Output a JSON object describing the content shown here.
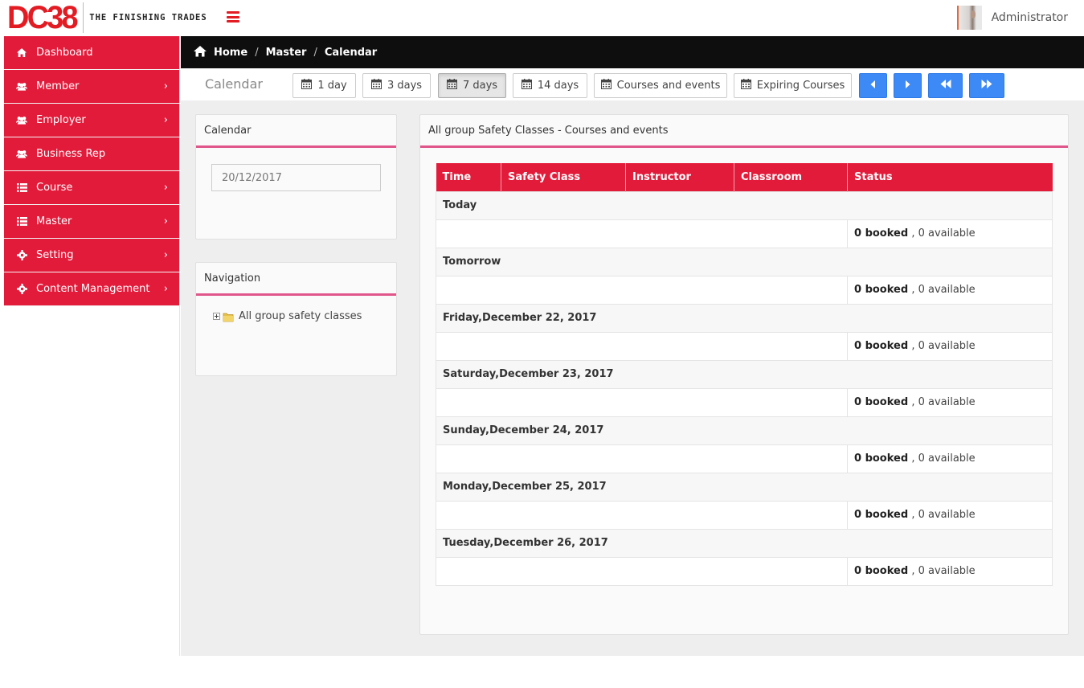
{
  "header": {
    "logo_text": "DC38",
    "tagline": "THE FINISHING TRADES",
    "user_name": "Administrator"
  },
  "sidebar": {
    "items": [
      {
        "label": "Dashboard",
        "icon": "home-icon",
        "has_children": false
      },
      {
        "label": "Member",
        "icon": "users-icon",
        "has_children": true
      },
      {
        "label": "Employer",
        "icon": "users-icon",
        "has_children": true
      },
      {
        "label": "Business Rep",
        "icon": "users-icon",
        "has_children": false
      },
      {
        "label": "Course",
        "icon": "list-icon",
        "has_children": true
      },
      {
        "label": "Master",
        "icon": "list-icon",
        "has_children": true
      },
      {
        "label": "Setting",
        "icon": "gear-icon",
        "has_children": true
      },
      {
        "label": "Content Management",
        "icon": "gear-icon",
        "has_children": true
      }
    ]
  },
  "breadcrumb": {
    "items": [
      "Home",
      "Master",
      "Calendar"
    ],
    "separator": "/"
  },
  "toolbar": {
    "title": "Calendar",
    "buttons": [
      {
        "label": "1 day",
        "active": false
      },
      {
        "label": "3 days",
        "active": false
      },
      {
        "label": "7 days",
        "active": true
      },
      {
        "label": "14 days",
        "active": false
      },
      {
        "label": "Courses and events",
        "active": false
      },
      {
        "label": "Expiring Courses",
        "active": false
      }
    ],
    "nav_buttons": [
      "caret-left-icon",
      "caret-right-icon",
      "fast-backward-icon",
      "fast-forward-icon"
    ]
  },
  "calendar_panel": {
    "title": "Calendar",
    "date_value": "20/12/2017"
  },
  "navigation_panel": {
    "title": "Navigation",
    "tree_item": "All group safety classes"
  },
  "schedule_panel": {
    "title": "All group Safety Classes - Courses and events",
    "columns": [
      "Time",
      "Safety Class",
      "Instructor",
      "Classroom",
      "Status"
    ],
    "booked_suffix": ", 0 available",
    "days": [
      {
        "label": "Today",
        "booked": "0 booked",
        "available": ", 0 available"
      },
      {
        "label": "Tomorrow",
        "booked": "0 booked",
        "available": ", 0 available"
      },
      {
        "label": "Friday,December 22, 2017",
        "booked": "0 booked",
        "available": ", 0 available"
      },
      {
        "label": "Saturday,December 23, 2017",
        "booked": "0 booked",
        "available": ", 0 available"
      },
      {
        "label": "Sunday,December 24, 2017",
        "booked": "0 booked",
        "available": ", 0 available"
      },
      {
        "label": "Monday,December 25, 2017",
        "booked": "0 booked",
        "available": ", 0 available"
      },
      {
        "label": "Tuesday,December 26, 2017",
        "booked": "0 booked",
        "available": ", 0 available"
      }
    ]
  },
  "colors": {
    "brand_red": "#e31b3b",
    "accent_pink": "#e0568a",
    "nav_blue": "#3d8af7",
    "breadcrumb_bg": "#0e0e0e"
  }
}
